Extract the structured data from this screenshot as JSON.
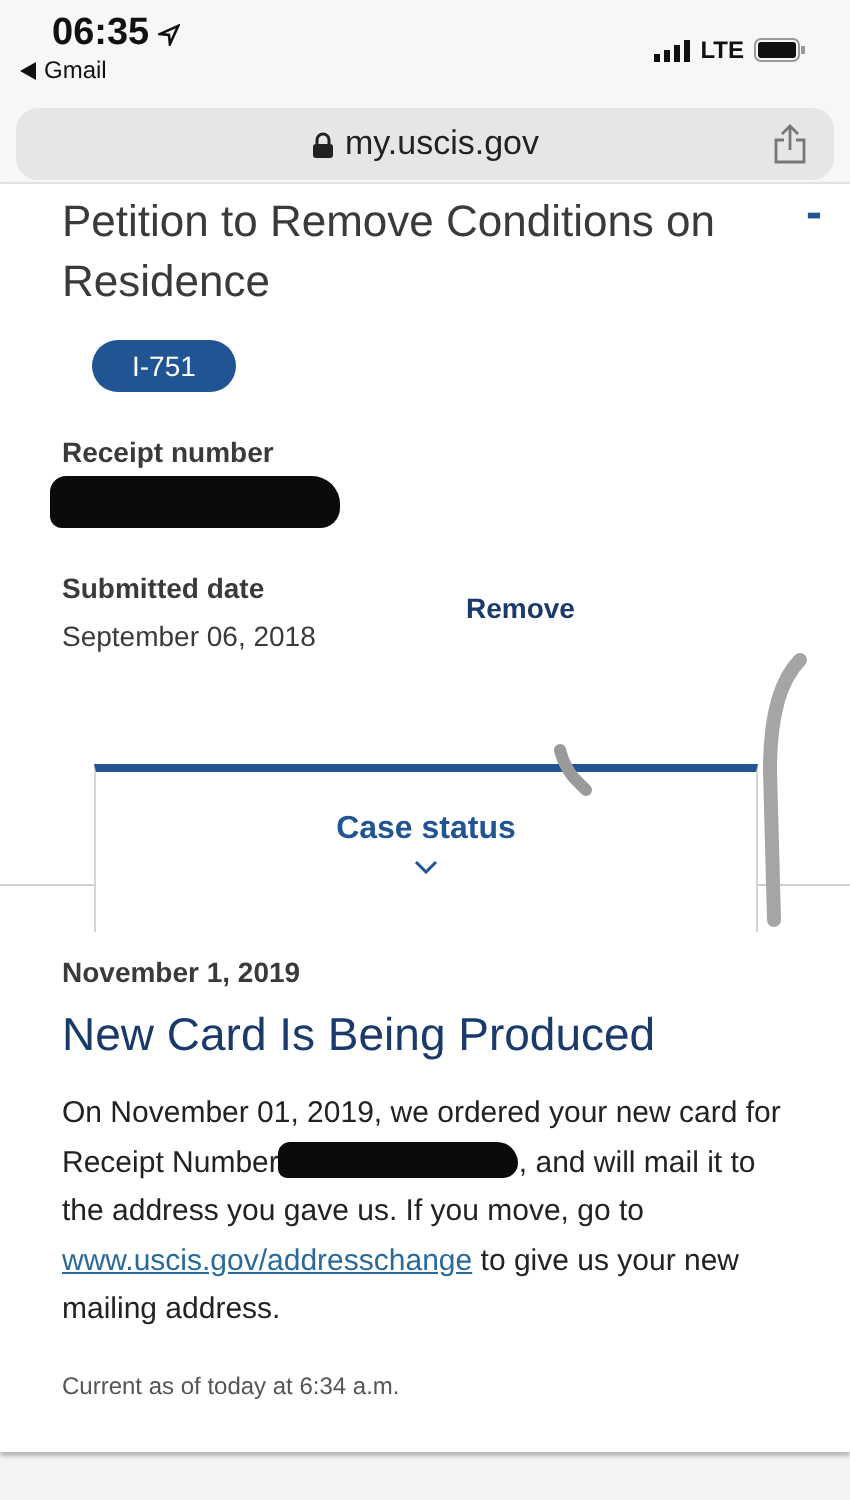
{
  "status_bar": {
    "time": "06:35",
    "back_app": "Gmail",
    "network": "LTE"
  },
  "address_bar": {
    "url": "my.uscis.gov"
  },
  "case": {
    "title": "Petition to Remove Conditions on Residence",
    "collapse_symbol": "-",
    "form_badge": "I-751",
    "fields": [
      {
        "label": "Receipt number",
        "redacted": true
      },
      {
        "label": "Submitted date",
        "value": "September 06, 2018"
      }
    ],
    "remove_link": "Remove",
    "tab": {
      "label": "Case status",
      "expanded": true
    },
    "status": {
      "date": "November 1, 2019",
      "heading": "New Card Is Being Produced",
      "message_before": "On November 01, 2019, we ordered your new card for Receipt Number",
      "message_after": ", and will mail it to the address you gave us. If you move, go to",
      "link": "www.uscis.gov/addresschange",
      "message_end": "to give us your new mailing address.",
      "updated": "Current as of today at 6:34 a.m."
    }
  }
}
